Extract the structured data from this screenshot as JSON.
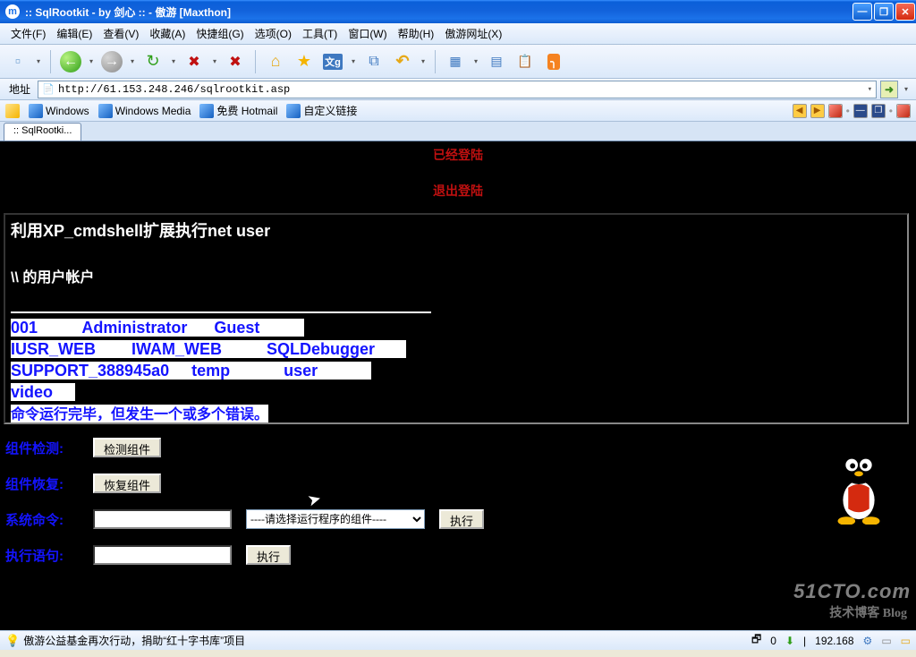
{
  "window": {
    "title": ":: SqlRootkit - by 剑心 :: - 傲游 [Maxthon]"
  },
  "menu": {
    "file": "文件(F)",
    "edit": "编辑(E)",
    "view": "查看(V)",
    "fav": "收藏(A)",
    "group": "快捷组(G)",
    "options": "选项(O)",
    "tools": "工具(T)",
    "window": "窗口(W)",
    "help": "帮助(H)",
    "aoyou": "傲游网址(X)"
  },
  "address": {
    "label": "地址",
    "url": "http://61.153.248.246/sqlrootkit.asp"
  },
  "links": {
    "windows": "Windows",
    "wmedia": "Windows Media",
    "hotmail": "免费 Hotmail",
    "custom": "自定义链接"
  },
  "tab": {
    "label": ":: SqlRootki..."
  },
  "page": {
    "login_status": "已经登陆",
    "logout": "退出登陆",
    "output_title": "利用XP_cmdshell扩展执行net user",
    "accounts_header": "\\\\ 的用户帐户",
    "users_line1": "001          Administrator      Guest          ",
    "users_line2": "IUSR_WEB        IWAM_WEB          SQLDebugger       ",
    "users_line3": "SUPPORT_388945a0     temp            user            ",
    "users_line4": "video     ",
    "finish_msg": "命令运行完毕，但发生一个或多个错误。",
    "labels": {
      "detect": "组件检测:",
      "restore": "组件恢复:",
      "syscmd": "系统命令:",
      "execsql": "执行语句:"
    },
    "buttons": {
      "detect": "检测组件",
      "restore": "恢复组件",
      "exec1": "执行",
      "exec2": "执行"
    },
    "select_placeholder": "----请选择运行程序的组件----"
  },
  "status": {
    "left": "傲游公益基金再次行动，捐助“红十字书库”项目",
    "count": "0",
    "ip": "192.168"
  },
  "watermark": {
    "url": "51CTO.com",
    "sub": "技术博客  Blog"
  }
}
